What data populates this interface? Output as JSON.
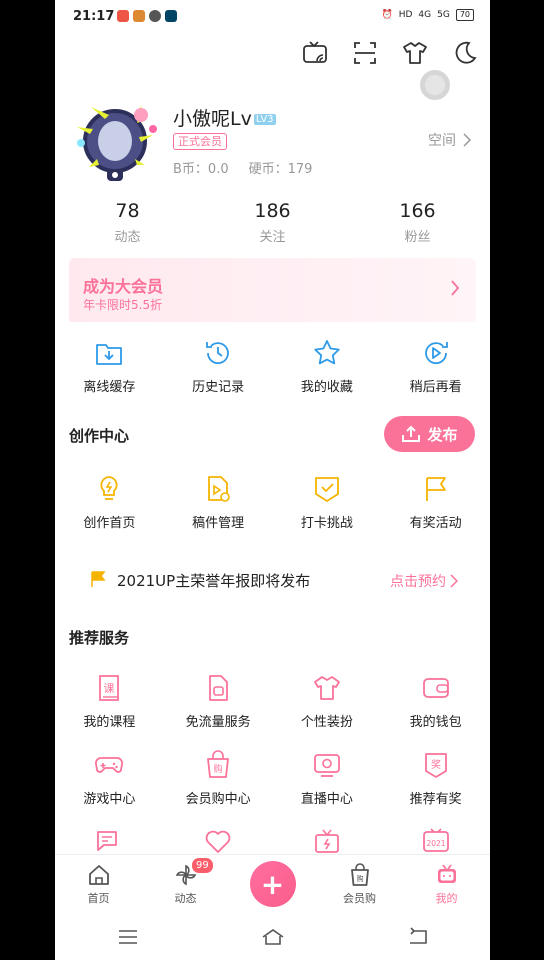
{
  "status": {
    "time": "21:17",
    "battery": "70"
  },
  "profile": {
    "name": "小傲呢Lv",
    "level": "LV3",
    "vip_badge": "正式会员",
    "b_coin": "B币：0.0",
    "hard_coin": "硬币：179",
    "space_link": "空间"
  },
  "stats": [
    {
      "num": "78",
      "label": "动态"
    },
    {
      "num": "186",
      "label": "关注"
    },
    {
      "num": "166",
      "label": "粉丝"
    }
  ],
  "vip_banner": {
    "title": "成为大会员",
    "subtitle": "年卡限时5.5折"
  },
  "quick": [
    {
      "label": "离线缓存",
      "icon": "download-folder-icon"
    },
    {
      "label": "历史记录",
      "icon": "history-icon"
    },
    {
      "label": "我的收藏",
      "icon": "star-icon"
    },
    {
      "label": "稍后再看",
      "icon": "watch-later-icon"
    }
  ],
  "creation": {
    "title": "创作中心",
    "publish": "发布",
    "items": [
      {
        "label": "创作首页",
        "icon": "bulb-icon"
      },
      {
        "label": "稿件管理",
        "icon": "document-play-icon"
      },
      {
        "label": "打卡挑战",
        "icon": "checkin-icon"
      },
      {
        "label": "有奖活动",
        "icon": "flag-icon"
      }
    ]
  },
  "notice": {
    "text": "2021UP主荣誉年报即将发布",
    "link": "点击预约"
  },
  "services": {
    "title": "推荐服务",
    "row1": [
      {
        "label": "我的课程",
        "icon": "course-icon",
        "glyph": "课"
      },
      {
        "label": "免流量服务",
        "icon": "sim-card-icon"
      },
      {
        "label": "个性装扮",
        "icon": "tshirt-icon"
      },
      {
        "label": "我的钱包",
        "icon": "wallet-icon"
      }
    ],
    "row2": [
      {
        "label": "游戏中心",
        "icon": "gamepad-icon"
      },
      {
        "label": "会员购中心",
        "icon": "shopping-bag-icon",
        "glyph": "购"
      },
      {
        "label": "直播中心",
        "icon": "live-tv-icon"
      },
      {
        "label": "推荐有奖",
        "icon": "reward-icon",
        "glyph": "奖"
      }
    ],
    "row3": [
      {
        "icon": "chat-icon"
      },
      {
        "icon": "heart-icon"
      },
      {
        "icon": "gift-icon"
      },
      {
        "icon": "year-2021-icon",
        "glyph": "2021"
      }
    ]
  },
  "bottom_nav": [
    {
      "label": "首页",
      "icon": "home-icon"
    },
    {
      "label": "动态",
      "icon": "pinwheel-icon",
      "badge": "99"
    },
    {
      "label": "",
      "icon": "plus-icon"
    },
    {
      "label": "会员购",
      "icon": "shopping-bag-icon",
      "glyph": "购"
    },
    {
      "label": "我的",
      "icon": "tv-icon"
    }
  ],
  "colors": {
    "accent": "#fb7299",
    "blue": "#2e9ae8",
    "yellow": "#f5b400"
  }
}
